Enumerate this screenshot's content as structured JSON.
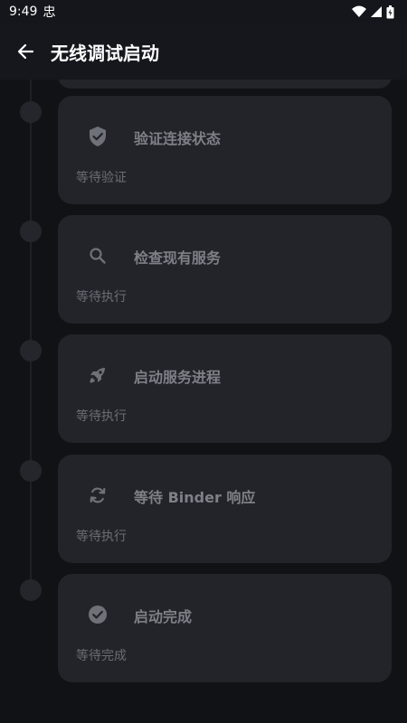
{
  "status_bar": {
    "time": "9:49",
    "app_glyph": "忠"
  },
  "app_bar": {
    "title": "无线调试启动",
    "back_icon": "arrow-back-icon"
  },
  "steps": [
    {
      "icon": "shield-check-icon",
      "title": "验证连接状态",
      "status": "等待验证"
    },
    {
      "icon": "search-icon",
      "title": "检查现有服务",
      "status": "等待执行"
    },
    {
      "icon": "rocket-icon",
      "title": "启动服务进程",
      "status": "等待执行"
    },
    {
      "icon": "sync-icon",
      "title": "等待 Binder 响应",
      "status": "等待执行"
    },
    {
      "icon": "check-circle-icon",
      "title": "启动完成",
      "status": "等待完成"
    }
  ],
  "colors": {
    "background": "#111215",
    "card": "#23242a",
    "icon": "#6f7178"
  }
}
